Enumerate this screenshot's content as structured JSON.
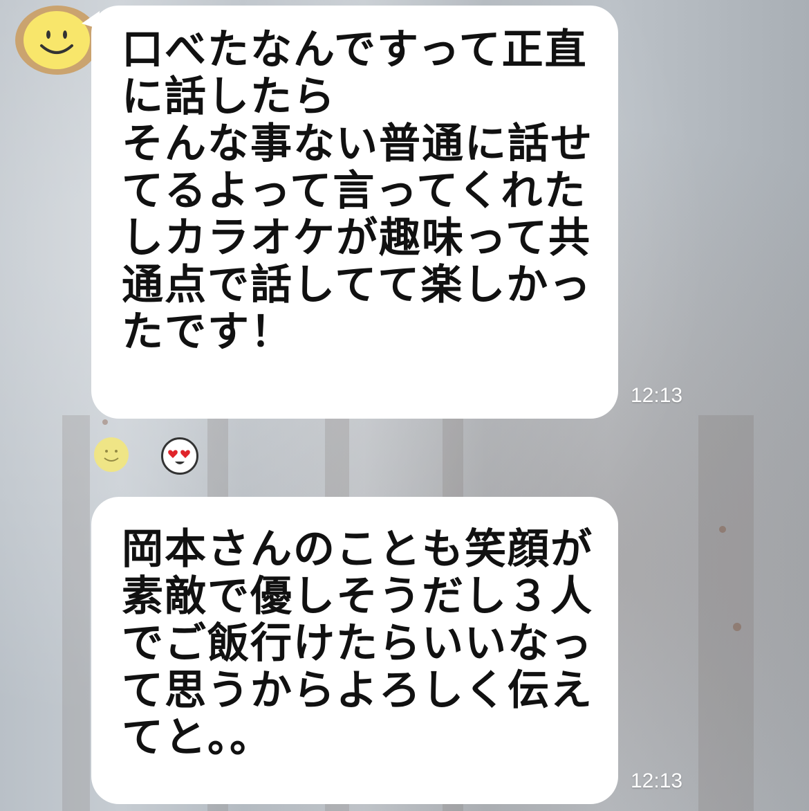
{
  "messages": [
    {
      "lines": [
        "口べたなんですって正直",
        "に話したら",
        "そんな事ない普通に話せ",
        "てるよって言ってくれた",
        "しカラオケが趣味って共",
        "通点で話してて楽しかっ",
        "たです！"
      ],
      "time": "12:13"
    },
    {
      "lines": [
        "岡本さんのことも笑顔が",
        "素敵で優しそうだし３人",
        "でご飯行けたらいいなっ",
        "て思うからよろしく伝え",
        "てと。。"
      ],
      "time": "12:13"
    }
  ],
  "reactions": [
    "smile-emoji-icon",
    "heart-eyes-emoji-icon"
  ],
  "colors": {
    "bubble": "#ffffff",
    "avatar": "#f8e66b",
    "time": "#ffffff"
  }
}
